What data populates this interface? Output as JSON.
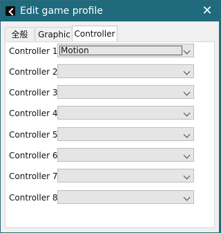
{
  "window": {
    "title": "Edit game profile"
  },
  "tabs": [
    {
      "label": "全般"
    },
    {
      "label": "Graphic"
    },
    {
      "label": "Controller"
    }
  ],
  "controllers": [
    {
      "label": "Controller 1",
      "value": "Motion"
    },
    {
      "label": "Controller 2",
      "value": ""
    },
    {
      "label": "Controller 3",
      "value": ""
    },
    {
      "label": "Controller 4",
      "value": ""
    },
    {
      "label": "Controller 5",
      "value": ""
    },
    {
      "label": "Controller 6",
      "value": ""
    },
    {
      "label": "Controller 7",
      "value": ""
    },
    {
      "label": "Controller 8",
      "value": ""
    }
  ],
  "colors": {
    "titlebar": "#1f6a7c"
  }
}
